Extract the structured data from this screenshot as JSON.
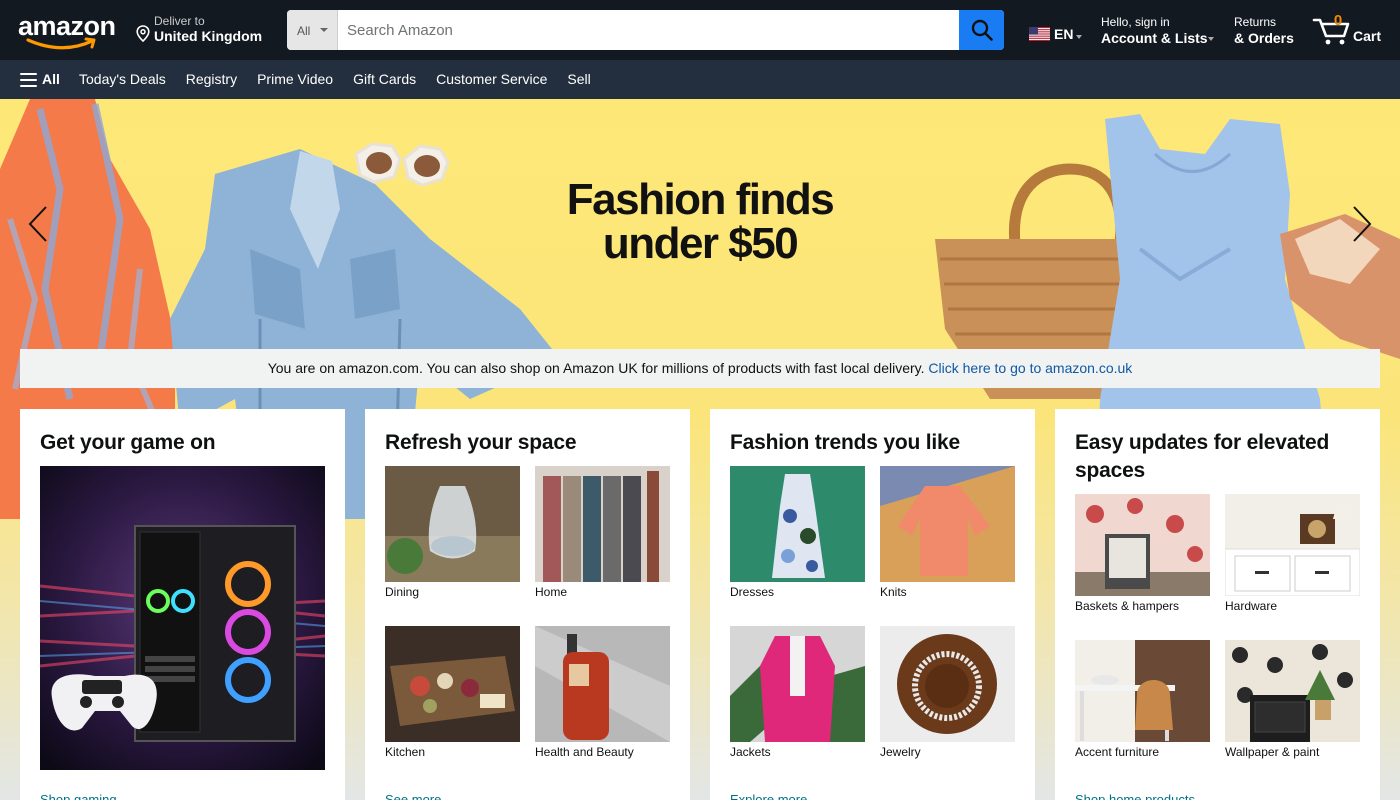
{
  "header": {
    "logo_text": "amazon",
    "deliver_line1": "Deliver to",
    "deliver_line2": "United Kingdom",
    "search_category": "All",
    "search_placeholder": "Search Amazon",
    "language": "EN",
    "account_line1": "Hello, sign in",
    "account_line2": "Account & Lists",
    "orders_line1": "Returns",
    "orders_line2": "& Orders",
    "cart_count": "0",
    "cart_label": "Cart"
  },
  "nav": {
    "all_label": "All",
    "items": [
      "Today's Deals",
      "Registry",
      "Prime Video",
      "Gift Cards",
      "Customer Service",
      "Sell"
    ]
  },
  "hero": {
    "title_line1": "Fashion finds",
    "title_line2": "under $50"
  },
  "notice": {
    "text": "You are on amazon.com. You can also shop on Amazon UK for millions of products with fast local delivery. ",
    "link": "Click here to go to amazon.co.uk"
  },
  "cards": [
    {
      "title": "Get your game on",
      "more": "Shop gaming"
    },
    {
      "title": "Refresh your space",
      "more": "See more",
      "tiles": [
        "Dining",
        "Home",
        "Kitchen",
        "Health and Beauty"
      ]
    },
    {
      "title": "Fashion trends you like",
      "more": "Explore more",
      "tiles": [
        "Dresses",
        "Knits",
        "Jackets",
        "Jewelry"
      ]
    },
    {
      "title": "Easy updates for elevated spaces",
      "more": "Shop home products",
      "tiles": [
        "Baskets & hampers",
        "Hardware",
        "Accent furniture",
        "Wallpaper & paint"
      ]
    }
  ],
  "colors": {
    "header_bg": "#131921",
    "nav_bg": "#232f3e",
    "search_button": "#1a7cf3",
    "cart_count": "#f08804",
    "hero_bg": "#fde877",
    "link": "#007185"
  },
  "icons": [
    "location-pin-icon",
    "search-icon",
    "us-flag-icon",
    "cart-icon",
    "hamburger-icon",
    "chevron-left-icon",
    "chevron-right-icon"
  ]
}
